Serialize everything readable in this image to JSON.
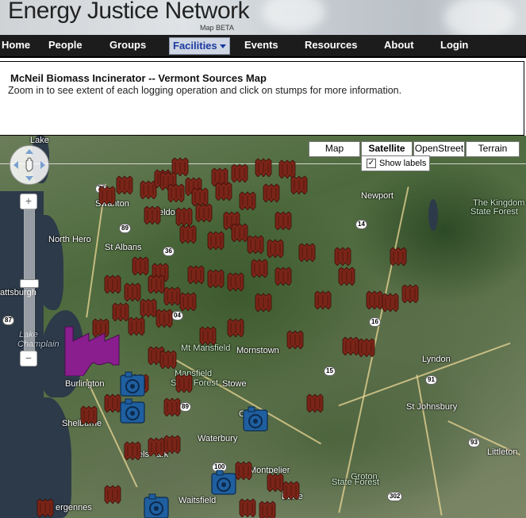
{
  "header": {
    "title": "Energy Justice Network",
    "subtitle": "Map BETA"
  },
  "nav": {
    "items": [
      {
        "label": "Home"
      },
      {
        "label": "People"
      },
      {
        "label": "Groups"
      },
      {
        "label": "Facilities"
      },
      {
        "label": "Events"
      },
      {
        "label": "Resources"
      },
      {
        "label": "About"
      },
      {
        "label": "Login"
      }
    ],
    "active": "Facilities"
  },
  "page": {
    "title": "McNeil Biomass Incinerator -- Vermont Sources Map",
    "description": "Zoom in to see extent of each logging operation and click on stumps for more information."
  },
  "map_controls": {
    "types": [
      {
        "label": "Map"
      },
      {
        "label": "Satellite"
      },
      {
        "label": "OpenStreet"
      },
      {
        "label": "Terrain"
      }
    ],
    "active_type": "Satellite",
    "show_labels": {
      "label": "Show labels",
      "checked": true
    },
    "zoom_in": "+",
    "zoom_out": "−"
  },
  "places": [
    "Lake",
    "Swanton",
    "Newport",
    "The Kingdom",
    "State Forest",
    "North Hero",
    "St Albans",
    "attsburgh",
    "Lake",
    "Champlain",
    "Mt Mansfield",
    "Mornstown",
    "Lyndon",
    "olchester",
    "Mansfield",
    "State Forest",
    "Burlington",
    "Stowe",
    "St Johnsbury",
    "Shelburne",
    "Waterbury",
    "Littleton",
    "Montpelier",
    "Groton",
    "State Forest",
    "Barre",
    "Waitsfield",
    "ergennes",
    "eldon",
    "els",
    "ark",
    "C"
  ],
  "route_shields": [
    "78",
    "89",
    "36",
    "14",
    "87",
    "04",
    "16",
    "15",
    "91",
    "89",
    "93",
    "100",
    "302"
  ],
  "colors": {
    "stump": "#7a2418",
    "plant": "#1f5fa0",
    "factory": "#8a1e8f",
    "nav_bg": "#1c1c1c"
  }
}
